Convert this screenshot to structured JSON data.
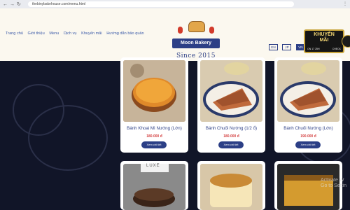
{
  "browser": {
    "url": "thebinybakehouse.com/menu.html",
    "back_icon": "←",
    "forward_icon": "→",
    "reload_icon": "↻"
  },
  "header": {
    "nav_items": [
      "Trang chủ",
      "Giới thiệu",
      "Menu",
      "Dịch vụ",
      "Khuyến mãi",
      "Hướng dẫn bảo quản"
    ],
    "logo_text": "Moon Bakery",
    "since": "Since 2015",
    "languages": [
      "EN",
      "JP",
      "VN"
    ],
    "promo": {
      "title_line1": "KHUYẾN",
      "title_line2": "MÃI",
      "sub": "ON 17 25H",
      "check": "CHECK"
    }
  },
  "products": [
    {
      "name": "Bánh Khoai Mì Nướng (Lớn)",
      "price": "180.000 đ",
      "button": "Xem chi tiết"
    },
    {
      "name": "Bánh Chuối Nướng (1/2 ổ)",
      "price": "180.000 đ",
      "button": "Xem chi tiết"
    },
    {
      "name": "Bánh Chuối Nướng (Lớn)",
      "price": "190.000 đ",
      "button": "Xem chi tiết"
    }
  ],
  "second_row_labels": [
    "LUXE"
  ],
  "watermark": "Activate W\nGo to Settin"
}
